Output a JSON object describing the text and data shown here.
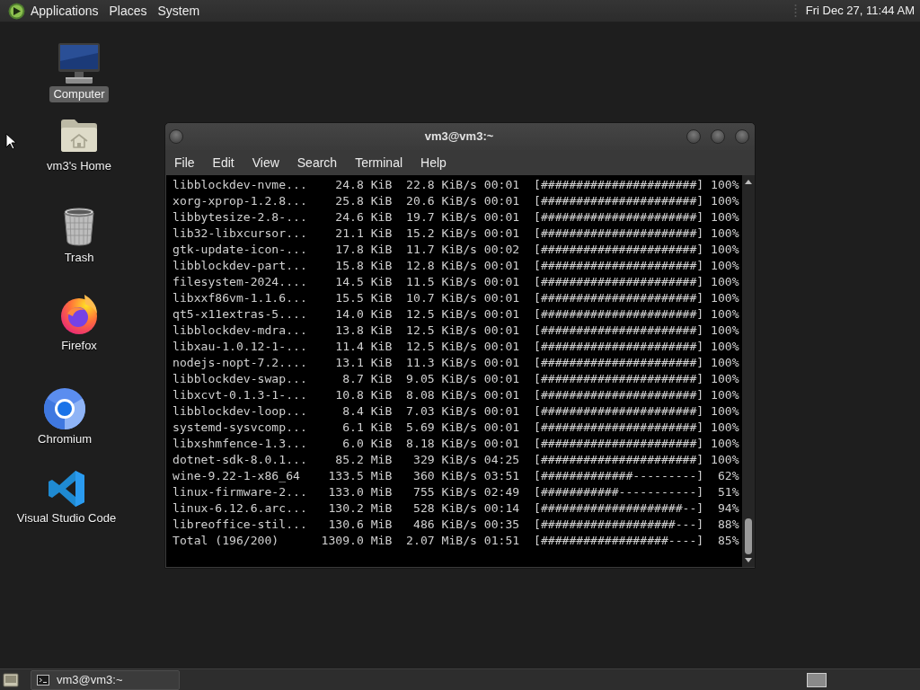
{
  "top_panel": {
    "menus": [
      "Applications",
      "Places",
      "System"
    ],
    "clock": "Fri Dec 27, 11:44 AM"
  },
  "desktop_icons": [
    {
      "kind": "computer",
      "label": "Computer",
      "selected": true
    },
    {
      "kind": "home",
      "label": "vm3's Home",
      "selected": false
    },
    {
      "kind": "trash",
      "label": "Trash",
      "selected": false
    },
    {
      "kind": "firefox",
      "label": "Firefox",
      "selected": false
    },
    {
      "kind": "chromium",
      "label": "Chromium",
      "selected": false
    },
    {
      "kind": "vscode",
      "label": "Visual Studio Code",
      "selected": false
    }
  ],
  "terminal_window": {
    "title": "vm3@vm3:~",
    "menu": [
      "File",
      "Edit",
      "View",
      "Search",
      "Terminal",
      "Help"
    ],
    "lines": [
      {
        "name": "libblockdev-nvme...",
        "size": "24.8 KiB",
        "speed": "22.8 KiB/s",
        "eta": "00:01",
        "bar": "[######################]",
        "percent": "100%"
      },
      {
        "name": "xorg-xprop-1.2.8...",
        "size": "25.8 KiB",
        "speed": "20.6 KiB/s",
        "eta": "00:01",
        "bar": "[######################]",
        "percent": "100%"
      },
      {
        "name": "libbytesize-2.8-...",
        "size": "24.6 KiB",
        "speed": "19.7 KiB/s",
        "eta": "00:01",
        "bar": "[######################]",
        "percent": "100%"
      },
      {
        "name": "lib32-libxcursor...",
        "size": "21.1 KiB",
        "speed": "15.2 KiB/s",
        "eta": "00:01",
        "bar": "[######################]",
        "percent": "100%"
      },
      {
        "name": "gtk-update-icon-...",
        "size": "17.8 KiB",
        "speed": "11.7 KiB/s",
        "eta": "00:02",
        "bar": "[######################]",
        "percent": "100%"
      },
      {
        "name": "libblockdev-part...",
        "size": "15.8 KiB",
        "speed": "12.8 KiB/s",
        "eta": "00:01",
        "bar": "[######################]",
        "percent": "100%"
      },
      {
        "name": "filesystem-2024....",
        "size": "14.5 KiB",
        "speed": "11.5 KiB/s",
        "eta": "00:01",
        "bar": "[######################]",
        "percent": "100%"
      },
      {
        "name": "libxxf86vm-1.1.6...",
        "size": "15.5 KiB",
        "speed": "10.7 KiB/s",
        "eta": "00:01",
        "bar": "[######################]",
        "percent": "100%"
      },
      {
        "name": "qt5-x11extras-5....",
        "size": "14.0 KiB",
        "speed": "12.5 KiB/s",
        "eta": "00:01",
        "bar": "[######################]",
        "percent": "100%"
      },
      {
        "name": "libblockdev-mdra...",
        "size": "13.8 KiB",
        "speed": "12.5 KiB/s",
        "eta": "00:01",
        "bar": "[######################]",
        "percent": "100%"
      },
      {
        "name": "libxau-1.0.12-1-...",
        "size": "11.4 KiB",
        "speed": "12.5 KiB/s",
        "eta": "00:01",
        "bar": "[######################]",
        "percent": "100%"
      },
      {
        "name": "nodejs-nopt-7.2....",
        "size": "13.1 KiB",
        "speed": "11.3 KiB/s",
        "eta": "00:01",
        "bar": "[######################]",
        "percent": "100%"
      },
      {
        "name": "libblockdev-swap...",
        "size": "8.7 KiB",
        "speed": "9.05 KiB/s",
        "eta": "00:01",
        "bar": "[######################]",
        "percent": "100%"
      },
      {
        "name": "libxcvt-0.1.3-1-...",
        "size": "10.8 KiB",
        "speed": "8.08 KiB/s",
        "eta": "00:01",
        "bar": "[######################]",
        "percent": "100%"
      },
      {
        "name": "libblockdev-loop...",
        "size": "8.4 KiB",
        "speed": "7.03 KiB/s",
        "eta": "00:01",
        "bar": "[######################]",
        "percent": "100%"
      },
      {
        "name": "systemd-sysvcomp...",
        "size": "6.1 KiB",
        "speed": "5.69 KiB/s",
        "eta": "00:01",
        "bar": "[######################]",
        "percent": "100%"
      },
      {
        "name": "libxshmfence-1.3...",
        "size": "6.0 KiB",
        "speed": "8.18 KiB/s",
        "eta": "00:01",
        "bar": "[######################]",
        "percent": "100%"
      },
      {
        "name": "dotnet-sdk-8.0.1...",
        "size": "85.2 MiB",
        "speed": "329 KiB/s",
        "eta": "04:25",
        "bar": "[######################]",
        "percent": "100%"
      },
      {
        "name": "wine-9.22-1-x86_64",
        "size": "133.5 MiB",
        "speed": "360 KiB/s",
        "eta": "03:51",
        "bar": "[#############---------]",
        "percent": "62%"
      },
      {
        "name": "linux-firmware-2...",
        "size": "133.0 MiB",
        "speed": "755 KiB/s",
        "eta": "02:49",
        "bar": "[###########-----------]",
        "percent": "51%"
      },
      {
        "name": "linux-6.12.6.arc...",
        "size": "130.2 MiB",
        "speed": "528 KiB/s",
        "eta": "00:14",
        "bar": "[####################--]",
        "percent": "94%"
      },
      {
        "name": "libreoffice-stil...",
        "size": "130.6 MiB",
        "speed": "486 KiB/s",
        "eta": "00:35",
        "bar": "[###################---]",
        "percent": "88%"
      },
      {
        "name": "Total (196/200)",
        "size": "1309.0 MiB",
        "speed": "2.07 MiB/s",
        "eta": "01:51",
        "bar": "[##################----]",
        "percent": "85%"
      }
    ]
  },
  "bottom_panel": {
    "tasks": [
      {
        "label": "vm3@vm3:~"
      }
    ]
  }
}
